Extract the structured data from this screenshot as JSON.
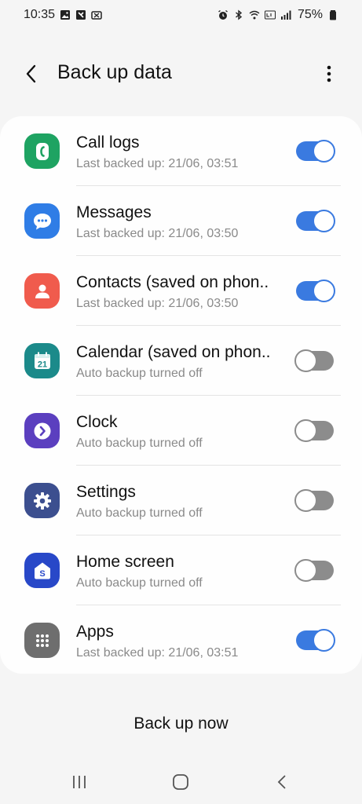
{
  "status_bar": {
    "time": "10:35",
    "battery": "75%",
    "left_icons": [
      "gallery-icon",
      "app-icon",
      "wallet-icon"
    ],
    "right_icons": [
      "alarm-icon",
      "bluetooth-icon",
      "wifi-icon",
      "volte-icon",
      "signal-icon",
      "battery-icon"
    ]
  },
  "header": {
    "title": "Back up data"
  },
  "items": [
    {
      "label": "Call logs",
      "status": "Last backed up: 21/06, 03:51",
      "enabled": true,
      "icon": "phone-icon",
      "color": "#1ea362"
    },
    {
      "label": "Messages",
      "status": "Last backed up: 21/06, 03:50",
      "enabled": true,
      "icon": "chat-bubble-icon",
      "color": "#2f7de6"
    },
    {
      "label": "Contacts (saved on phon..",
      "status": "Last backed up: 21/06, 03:50",
      "enabled": true,
      "icon": "person-icon",
      "color": "#f05b4d"
    },
    {
      "label": "Calendar (saved on phon..",
      "status": "Auto backup turned off",
      "enabled": false,
      "icon": "calendar-icon",
      "color": "#1b8a8a",
      "icon_text": "21"
    },
    {
      "label": "Clock",
      "status": "Auto backup turned off",
      "enabled": false,
      "icon": "clock-icon",
      "color": "#5b3fbf"
    },
    {
      "label": "Settings",
      "status": "Auto backup turned off",
      "enabled": false,
      "icon": "gear-icon",
      "color": "#3c4f8f"
    },
    {
      "label": "Home screen",
      "status": "Auto backup turned off",
      "enabled": false,
      "icon": "home-screen-icon",
      "color": "#2848c8",
      "icon_text": "S"
    },
    {
      "label": "Apps",
      "status": "Last backed up: 21/06, 03:51",
      "enabled": true,
      "icon": "apps-grid-icon",
      "color": "#6e6e6e"
    }
  ],
  "footer": {
    "backup_now_label": "Back up now"
  },
  "colors": {
    "toggle_on": "#3a7ae0",
    "toggle_off": "#8c8c8c",
    "background": "#f5f5f5"
  }
}
